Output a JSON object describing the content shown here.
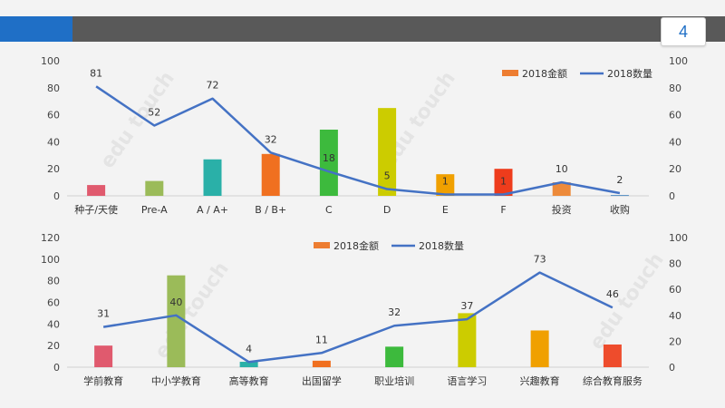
{
  "page": {
    "number": "4"
  },
  "colors": {
    "accent_blue": "#1f6fc6",
    "topbar": "#595959",
    "line": "#4472c4",
    "legend_bar": "#ed7d31"
  },
  "chart_data": [
    {
      "type": "bar",
      "categories": [
        "种子/天使",
        "Pre-A",
        "A / A+",
        "B / B+",
        "C",
        "D",
        "E",
        "F",
        "投资",
        "收购"
      ],
      "series": [
        {
          "name": "2018金额",
          "kind": "bar",
          "axis": "left",
          "values": [
            8,
            11,
            27,
            31,
            49,
            65,
            16,
            20,
            10,
            0.5
          ],
          "colors": [
            "#e05a6e",
            "#9bbb59",
            "#2ab0a8",
            "#f07020",
            "#3dba3d",
            "#cccc00",
            "#f0a000",
            "#ee3c1c",
            "#ed8a3a",
            "#2e75b6"
          ]
        },
        {
          "name": "2018数量",
          "kind": "line",
          "axis": "right",
          "values": [
            81,
            52,
            72,
            32,
            18,
            5,
            1,
            1,
            10,
            2
          ]
        }
      ],
      "ylim_left": [
        0,
        100
      ],
      "yticks_left": [
        0,
        20,
        40,
        60,
        80,
        100
      ],
      "ylim_right": [
        0,
        100
      ],
      "yticks_right": [
        0,
        20,
        40,
        60,
        80,
        100
      ],
      "legend": "top-right"
    },
    {
      "type": "bar",
      "categories": [
        "学前教育",
        "中小学教育",
        "高等教育",
        "出国留学",
        "职业培训",
        "语言学习",
        "兴趣教育",
        "综合教育服务"
      ],
      "series": [
        {
          "name": "2018金额",
          "kind": "bar",
          "axis": "left",
          "values": [
            20,
            85,
            5,
            6,
            19,
            50,
            34,
            21
          ],
          "colors": [
            "#e05a6e",
            "#9bbb59",
            "#2ab0a8",
            "#f07020",
            "#3dba3d",
            "#cccc00",
            "#f0a000",
            "#ee4c2c"
          ]
        },
        {
          "name": "2018数量",
          "kind": "line",
          "axis": "right",
          "values": [
            31,
            40,
            4,
            11,
            32,
            37,
            73,
            46
          ]
        }
      ],
      "ylim_left": [
        0,
        120
      ],
      "yticks_left": [
        0,
        20,
        40,
        60,
        80,
        100,
        120
      ],
      "ylim_right": [
        0,
        100
      ],
      "yticks_right": [
        0,
        20,
        40,
        60,
        80,
        100
      ],
      "legend": "top-center"
    }
  ]
}
